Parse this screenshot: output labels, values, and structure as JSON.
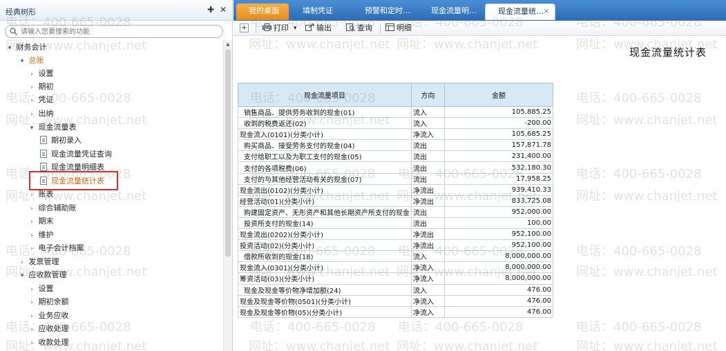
{
  "left_panel": {
    "title": "经典树形",
    "pin_icon": "✚",
    "close_icon": "✕",
    "search_placeholder": "请输入您要搜索的功能",
    "tree": [
      {
        "label": "财务会计",
        "arrow": "▾"
      },
      {
        "label": "总账",
        "arrow": "▾"
      },
      {
        "label": "设置",
        "arrow": "›"
      },
      {
        "label": "期初",
        "arrow": "›"
      },
      {
        "label": "凭证",
        "arrow": "›"
      },
      {
        "label": "出纳",
        "arrow": "›"
      },
      {
        "label": "现金流量表",
        "arrow": "▾"
      },
      {
        "label": "期初录入"
      },
      {
        "label": "现金流量凭证查询"
      },
      {
        "label": "现金流量明细表"
      },
      {
        "label": "现金流量统计表"
      },
      {
        "label": "账表",
        "arrow": "›"
      },
      {
        "label": "综合辅助账",
        "arrow": "›"
      },
      {
        "label": "期末",
        "arrow": "›"
      },
      {
        "label": "维护",
        "arrow": "›"
      },
      {
        "label": "电子会计档案",
        "arrow": "›"
      },
      {
        "label": "发票管理",
        "arrow": "›"
      },
      {
        "label": "应收款管理",
        "arrow": "▾"
      },
      {
        "label": "设置",
        "arrow": "›"
      },
      {
        "label": "期初余额",
        "arrow": "›"
      },
      {
        "label": "业务应收",
        "arrow": "›"
      },
      {
        "label": "应收处理",
        "arrow": "›"
      },
      {
        "label": "收款处理",
        "arrow": "›"
      }
    ]
  },
  "tabs": [
    {
      "label": "我的桌面"
    },
    {
      "label": "填制凭证"
    },
    {
      "label": "预警和定时…"
    },
    {
      "label": "现金流量明…"
    },
    {
      "label": "现金流量统…",
      "close": "×"
    }
  ],
  "toolbar": {
    "expand": "+",
    "print": "打印",
    "print_dropdown": "▾",
    "export": "输出",
    "query": "查询",
    "detail": "明细"
  },
  "report": {
    "title": "现金流量统计表",
    "columns": [
      "现金流量项目",
      "方向",
      "金额"
    ],
    "rows": [
      {
        "item": "销售商品、提供劳务收到的现金(01)",
        "dir": "流入",
        "amount": "105,885.25",
        "indent": true
      },
      {
        "item": "收到的税费返还(02)",
        "dir": "流入",
        "amount": "-200.00",
        "indent": true
      },
      {
        "item": "现金流入(0101)(分类小计)",
        "dir": "净流入",
        "amount": "105,685.25"
      },
      {
        "item": "购买商品、接受劳务支付的现金(04)",
        "dir": "流出",
        "amount": "157,871.78",
        "indent": true
      },
      {
        "item": "支付给职工以及为职工支付的现金(05)",
        "dir": "流出",
        "amount": "231,400.00",
        "indent": true
      },
      {
        "item": "支付的各项税费(06)",
        "dir": "流出",
        "amount": "532,180.30",
        "indent": true
      },
      {
        "item": "支付的与其他经营活动有关的现金(07)",
        "dir": "流出",
        "amount": "17,958.25",
        "indent": true
      },
      {
        "item": "现金流出(0102)(分类小计)",
        "dir": "净流出",
        "amount": "939,410.33"
      },
      {
        "item": "经营活动(01)(分类小计)",
        "dir": "净流出",
        "amount": "833,725.08"
      },
      {
        "item": "购建固定资产、无形资产和其他长期资产所支付的现金",
        "dir": "流出",
        "amount": "952,000.00",
        "indent": true
      },
      {
        "item": "投资所支付的现金(14)",
        "dir": "流出",
        "amount": "100.00",
        "indent": true
      },
      {
        "item": "现金流出(0202)(分类小计)",
        "dir": "净流出",
        "amount": "952,100.00"
      },
      {
        "item": "投资活动(02)(分类小计)",
        "dir": "净流出",
        "amount": "952,100.00"
      },
      {
        "item": "借款所收到的现金(18)",
        "dir": "流入",
        "amount": "8,000,000.00",
        "indent": true
      },
      {
        "item": "现金流入(0301)(分类小计)",
        "dir": "净流入",
        "amount": "8,000,000.00"
      },
      {
        "item": "筹资活动(03)(分类小计)",
        "dir": "净流入",
        "amount": "8,000,000.00"
      },
      {
        "item": "现金及现金等价物净增加额(24)",
        "dir": "流入",
        "amount": "476.00",
        "indent": true
      },
      {
        "item": "现金及现金等价物(0501)(分类小计)",
        "dir": "净流入",
        "amount": "476.00"
      },
      {
        "item": "现金及现金等价物(05)(分类小计)",
        "dir": "净流入",
        "amount": "476.00"
      }
    ]
  },
  "watermark": {
    "phone": "电话：400-665-0028",
    "site": "网址：www.chanjet.net"
  }
}
